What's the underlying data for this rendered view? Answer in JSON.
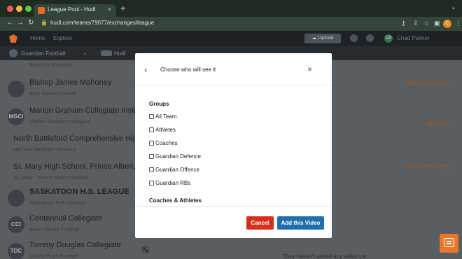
{
  "browser": {
    "tab_title": "League Pool - Hudl",
    "tab_close": "×",
    "new_tab": "+",
    "url": "hudl.com/teams/79077/exchanges/league",
    "profile_initial": "C"
  },
  "appnav": {
    "home": "Home",
    "explore": "Explore",
    "upload": "Upload",
    "user_initials": "CP",
    "user_name": "Chad Palmer"
  },
  "subnav": {
    "team_name": "Guardian Football",
    "dropdown": "⌄",
    "hudl": "Hudl"
  },
  "list": {
    "partial_top_sub": "Beard Sr. Football",
    "rows": [
      {
        "initials": "",
        "title": "Bishop James Mahoney",
        "sub": "BJM Saints Football",
        "action": "Add to Your Library"
      },
      {
        "initials": "MGCI",
        "title": "Marion Graham Collegiate Institute",
        "sub": "Marion Graham Collegiate",
        "action": "Add Again"
      },
      {
        "initials": "",
        "title": "North Battleford Comprehensive High S",
        "sub": "NBCHS SENIOR VIKINGS",
        "action": ""
      },
      {
        "initials": "",
        "title": "St. Mary High School, Prince Albert, Sa",
        "sub": "St. Mary · Prince Albert Football",
        "action": "Add to Your Library"
      },
      {
        "initials": "",
        "title": "SASKATOON H.S. LEAGUE",
        "sub": "Saskatoon H.S. League",
        "action": ""
      },
      {
        "initials": "CCI",
        "title": "Centennial Collegiate",
        "sub": "Boys' Varsity Football",
        "action": ""
      },
      {
        "initials": "TDC",
        "title": "Tommy Douglas Collegiate",
        "sub": "Varsity Boys Football",
        "action": ""
      }
    ],
    "empty_message": "They haven't added any video yet."
  },
  "modal": {
    "back": "‹",
    "title": "Choose who will see it",
    "close": "×",
    "groups_heading": "Groups",
    "groups": [
      "All Team",
      "Athletes",
      "Coaches",
      "Guardian Defence",
      "Guardian Offence",
      "Guardian RBs"
    ],
    "coaches_athletes_heading": "Coaches & Athletes",
    "cancel_label": "Cancel",
    "add_label": "Add this Video"
  },
  "colors": {
    "cancel": "#d7301a",
    "primary": "#1f6fae",
    "accent": "#e8772a"
  }
}
